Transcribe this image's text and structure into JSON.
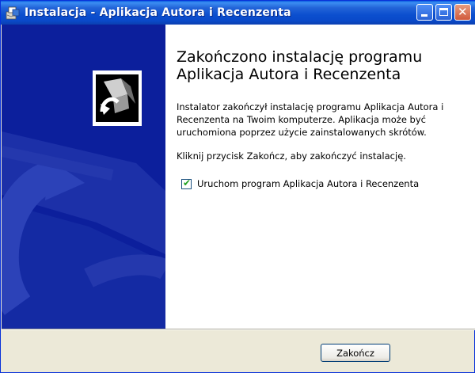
{
  "window": {
    "title": "Instalacja - Aplikacja Autora i Recenzenta",
    "icon": "installer-icon",
    "controls": [
      "minimize-icon",
      "maximize-icon",
      "close-icon"
    ]
  },
  "page": {
    "heading_line1": "Zakończono instalację programu",
    "heading_line2": "Aplikacja Autora i Recenzenta",
    "paragraph1": "Instalator zakończył instalację programu Aplikacja Autora i Recenzenta na Twoim komputerze. Aplikacja może być uruchomiona poprzez użycie zainstalowanych skrótów.",
    "paragraph2": "Kliknij przycisk Zakończ, aby zakończyć instalację.",
    "run_checkbox": {
      "label": "Uruchom program Aplikacja Autora i Recenzenta",
      "checked": true
    }
  },
  "buttons": {
    "finish": "Zakończ"
  },
  "colors": {
    "side_panel": "#0c1f9c",
    "titlebar": "#0b4fcf",
    "dialog_bg": "#ece9d8"
  }
}
